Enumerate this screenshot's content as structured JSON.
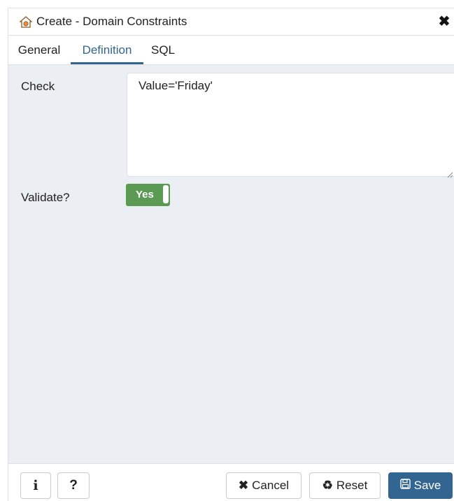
{
  "dialog": {
    "title": "Create - Domain Constraints",
    "close_symbol": "✖",
    "title_icon": "domain-constraint-icon"
  },
  "tabs": [
    {
      "label": "General",
      "active": false
    },
    {
      "label": "Definition",
      "active": true
    },
    {
      "label": "SQL",
      "active": false
    }
  ],
  "form": {
    "check_label": "Check",
    "check_value": "Value='Friday'",
    "validate_label": "Validate?",
    "validate_toggle_text": "Yes",
    "validate_on": true
  },
  "footer": {
    "info_label": "i",
    "help_label": "?",
    "cancel_label": "Cancel",
    "cancel_icon": "✖",
    "reset_label": "Reset",
    "reset_icon": "♻",
    "save_label": "Save",
    "save_icon": "🖫"
  },
  "colors": {
    "accent": "#326690",
    "toggle_on": "#5b9a53",
    "content_bg": "#ebeef3"
  }
}
